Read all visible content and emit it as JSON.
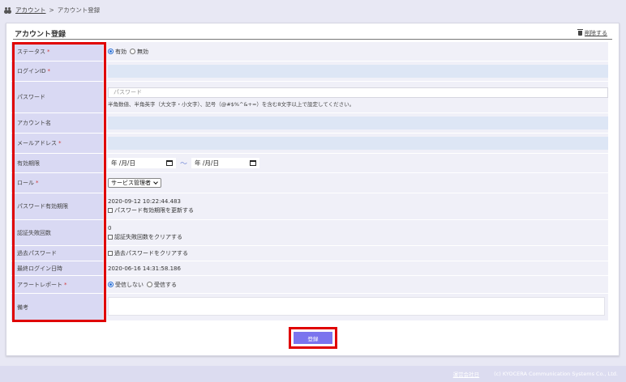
{
  "breadcrumb": {
    "home": "アカウント",
    "separator": ">",
    "current": "アカウント登録"
  },
  "card": {
    "title": "アカウント登録",
    "delete_label": "削除する"
  },
  "fields": {
    "status": {
      "label": "ステータス",
      "required": "*",
      "option_on": "有効",
      "option_off": "無効",
      "selected": "有効"
    },
    "login_id": {
      "label": "ログインID",
      "required": "*",
      "value": ""
    },
    "password": {
      "label": "パスワード",
      "placeholder": "パスワード",
      "hint": "半角数値、半角英字（大文字・小文字）、記号（@#$%^&+=）を含む8文字以上で設定してください。"
    },
    "account_name": {
      "label": "アカウント名",
      "value": ""
    },
    "email": {
      "label": "メールアドレス",
      "required": "*",
      "value": ""
    },
    "validity": {
      "label": "有効期限",
      "from": "年 /月/日",
      "separator": "～",
      "to": "年 /月/日"
    },
    "role": {
      "label": "ロール",
      "required": "*",
      "selected": "サービス管理者"
    },
    "password_expiry": {
      "label": "パスワード有効期限",
      "value": "2020-09-12 10:22:44.483",
      "checkbox": "パスワード有効期限を更新する"
    },
    "auth_failures": {
      "label": "認証失敗回数",
      "value": "0",
      "checkbox": "認証失敗回数をクリアする"
    },
    "past_passwords": {
      "label": "過去パスワード",
      "checkbox": "過去パスワードをクリアする"
    },
    "last_login": {
      "label": "最終ログイン日時",
      "value": "2020-06-16 14:31:58.186"
    },
    "alert_report": {
      "label": "アラートレポート",
      "required": "*",
      "option_no": "受信しない",
      "option_yes": "受信する",
      "selected": "受信しない"
    },
    "remarks": {
      "label": "備考",
      "value": ""
    }
  },
  "submit_label": "登録",
  "footer": {
    "corp_link": "運営会社日",
    "copyright": "(c) KYOCERA Communication Systems Co., Ltd."
  },
  "colors": {
    "label_bg": "#d9d9f3",
    "accent": "#7b74ee",
    "highlight": "#e00000",
    "required": "#d13a3a"
  }
}
